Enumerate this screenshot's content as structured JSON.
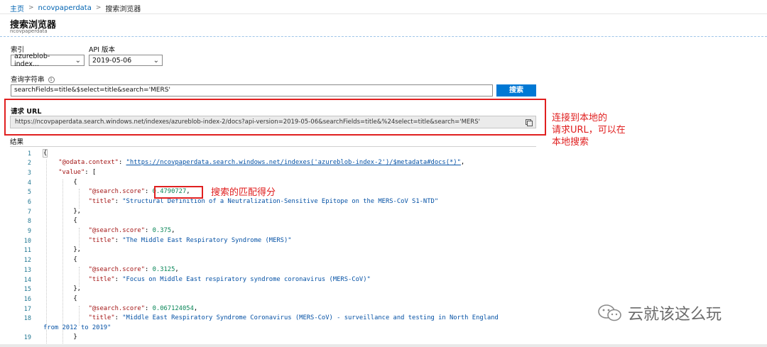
{
  "breadcrumb": {
    "home": "主页",
    "service": "ncovpaperdata",
    "current": "搜索浏览器",
    "sep": ">"
  },
  "page": {
    "title": "搜索浏览器",
    "subtitle": "ncovpaperdata"
  },
  "index": {
    "label": "索引",
    "value": "azureblob-index..."
  },
  "api": {
    "label": "API 版本",
    "value": "2019-05-06"
  },
  "query": {
    "label": "查询字符串",
    "value": "searchFields=title&$select=title&search='MERS'"
  },
  "search_button": "搜索",
  "request_url": {
    "label": "请求 URL",
    "value": "https://ncovpaperdata.search.windows.net/indexes/azureblob-index-2/docs?api-version=2019-05-06&searchFields=title&%24select=title&search='MERS'"
  },
  "annotations": {
    "url_note_1": "连接到本地的",
    "url_note_2": "请求URL，可以在",
    "url_note_3": "本地搜索",
    "score_note": "搜索的匹配得分"
  },
  "results": {
    "label": "结果",
    "line_numbers": [
      "1",
      "2",
      "3",
      "4",
      "5",
      "6",
      "7",
      "8",
      "9",
      "10",
      "11",
      "12",
      "13",
      "14",
      "15",
      "16",
      "17",
      "18",
      "19"
    ],
    "json": {
      "open_brace": "{",
      "context_key": "\"@odata.context\"",
      "context_value": "\"https://ncovpaperdata.search.windows.net/indexes('azureblob-index-2')/$metadata#docs(*)\"",
      "value_key": "\"value\"",
      "open_bracket": "[",
      "score_key": "\"@search.score\"",
      "title_key": "\"title\"",
      "items": [
        {
          "score": "0.4790727",
          "title": "\"Structural Definition of a Neutralization-Sensitive Epitope on the MERS-CoV S1-NTD\""
        },
        {
          "score": "0.375",
          "title": "\"The Middle East Respiratory Syndrome (MERS)\""
        },
        {
          "score": "0.3125",
          "title": "\"Focus on Middle East respiratory syndrome coronavirus (MERS-CoV)\""
        },
        {
          "score": "0.067124054",
          "title": "\"Middle East Respiratory Syndrome Coronavirus (MERS-CoV) - surveillance and testing in North England",
          "title_cont": "from 2012 to 2019\""
        }
      ]
    }
  },
  "watermark": "云就该这么玩"
}
